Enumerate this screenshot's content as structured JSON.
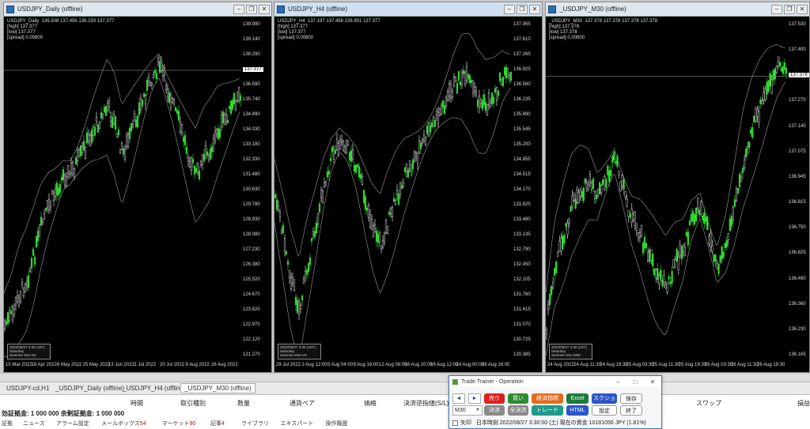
{
  "charts": [
    {
      "title": "USDJPY_Daily (offline)",
      "header_lines": [
        "USDJPY_Daily  136.508 137.456 136.193 137.377",
        "[high] 137.377",
        "[low] 137.377",
        "[spread] 0.00800"
      ],
      "price_labels": [
        "139.990",
        "139.140",
        "138.290",
        "137.377",
        "136.590",
        "135.740",
        "134.890",
        "134.030",
        "133.180",
        "132.330",
        "131.480",
        "130.630",
        "129.780",
        "128.930",
        "128.080",
        "127.230",
        "126.380",
        "125.520",
        "124.670",
        "123.820",
        "122.970",
        "122.120",
        "121.270"
      ],
      "current_price": "137.377",
      "time_labels": [
        "10 Mar 2022",
        "18 Apr 2022",
        "6 May 2022",
        "25 May 2022",
        "13 Jun 2022",
        "1 Jul 2022",
        "20 Jul 2022",
        "8 Aug 2022",
        "26 Aug 2022"
      ],
      "tooltip": "2022/08/27 3:30 (JST)\nSaturday\nSummer time  D1"
    },
    {
      "title": "USDJPY_H4 (offline)",
      "header_lines": [
        "USDJPY_H4  137.197 137.456 136.901 137.377",
        "[high] 137.377",
        "[low] 137.377",
        "[spread] 0.00800"
      ],
      "price_labels": [
        "137.955",
        "137.610",
        "137.265",
        "136.925",
        "136.580",
        "136.235",
        "135.890",
        "135.545",
        "135.200",
        "134.855",
        "134.515",
        "134.170",
        "133.825",
        "133.480",
        "133.135",
        "132.790",
        "132.450",
        "132.105",
        "131.760",
        "131.415",
        "131.070",
        "130.725",
        "130.385"
      ],
      "current_price": "137.377",
      "time_labels": [
        "29 Jul 2022",
        "2 Aug 12:00",
        "5 Aug 04:00",
        "9 Aug 16:00",
        "12 Aug 08:00",
        "16 Aug 20:00",
        "19 Aug 12:00",
        "24 Aug 00:00",
        "26 Aug 16:00"
      ],
      "tooltip": "2022/08/27 3:30 (JST)\nSaturday\nSummer time  H4"
    },
    {
      "title": "_USDJPY_M30 (offline)",
      "header_lines": [
        "_USDJPY_M30  137.378 137.378 137.378 137.378",
        "[high] 137.378",
        "[low] 137.378",
        "[spread] 0.00800"
      ],
      "price_labels": [
        "137.530",
        "137.400",
        "137.378",
        "137.270",
        "137.140",
        "137.075",
        "136.945",
        "136.815",
        "136.750",
        "136.625",
        "136.490",
        "136.360",
        "136.230",
        "136.165"
      ],
      "current_price": "137.378",
      "time_labels": [
        "24 Aug 2022",
        "24 Aug 11:30",
        "24 Aug 19:30",
        "25 Aug 03:30",
        "25 Aug 11:30",
        "25 Aug 19:30",
        "26 Aug 03:30",
        "26 Aug 11:30",
        "26 Aug 19:30"
      ],
      "tooltip": "2022/08/27 3:30 (JST)\nSaturday\nSummer time  M30"
    }
  ],
  "chart_tabs": [
    "USDJPY-cd,H1",
    "_USDJPY_Daily (offline)",
    "_USDJPY_H4 (offline)",
    "_USDJPY_M30 (offline)"
  ],
  "terminal": {
    "columns": [
      "時間",
      "取引種別",
      "数量",
      "通貨ペア",
      "価格",
      "決済逆指値(S/L)",
      "スワップ",
      "損益"
    ],
    "balance": "効証拠金: 1 000 000   余剰証拠金: 1 000 000",
    "tabs": [
      {
        "label": "証拠"
      },
      {
        "label": "ニュース"
      },
      {
        "label": "アラーム設定"
      },
      {
        "label": "メールボックス",
        "badge": "54"
      },
      {
        "label": "マーケット",
        "badge": "90"
      },
      {
        "label": "記事",
        "badge": "4"
      },
      {
        "label": "ライブラリ"
      },
      {
        "label": "エキスパート"
      },
      {
        "label": "操作履歴"
      }
    ]
  },
  "trade_trainer": {
    "title": "Trade Trainer - Operation",
    "nav_prev": "◄",
    "nav_next": "►",
    "timeframe": "M30",
    "buttons_row1": [
      {
        "label": "売り",
        "color": "#e01e1e"
      },
      {
        "label": "買い",
        "color": "#2e8b2e"
      },
      {
        "label": "経済指標",
        "color": "#e46b1b"
      },
      {
        "label": "Excel",
        "color": "#1f7a3a"
      },
      {
        "label": "スクショ",
        "color": "#2a55c8"
      },
      {
        "label": "保存",
        "color": "#ffffff"
      }
    ],
    "buttons_row2": [
      {
        "label": "決済",
        "color": "#8a8a8a"
      },
      {
        "label": "全決済",
        "color": "#8a8a8a"
      },
      {
        "label": "トレード",
        "color": "#1e9a8a"
      },
      {
        "label": "HTML",
        "color": "#2a55c8"
      },
      {
        "label": "設定",
        "color": "#ffffff"
      },
      {
        "label": "終了",
        "color": "#ffffff"
      }
    ],
    "checkbox_label": "矢印",
    "footer": "日本時刻 2022/08/27 3:30:00 (土)   現在の資金 10181056 JPY (1.81%)"
  }
}
